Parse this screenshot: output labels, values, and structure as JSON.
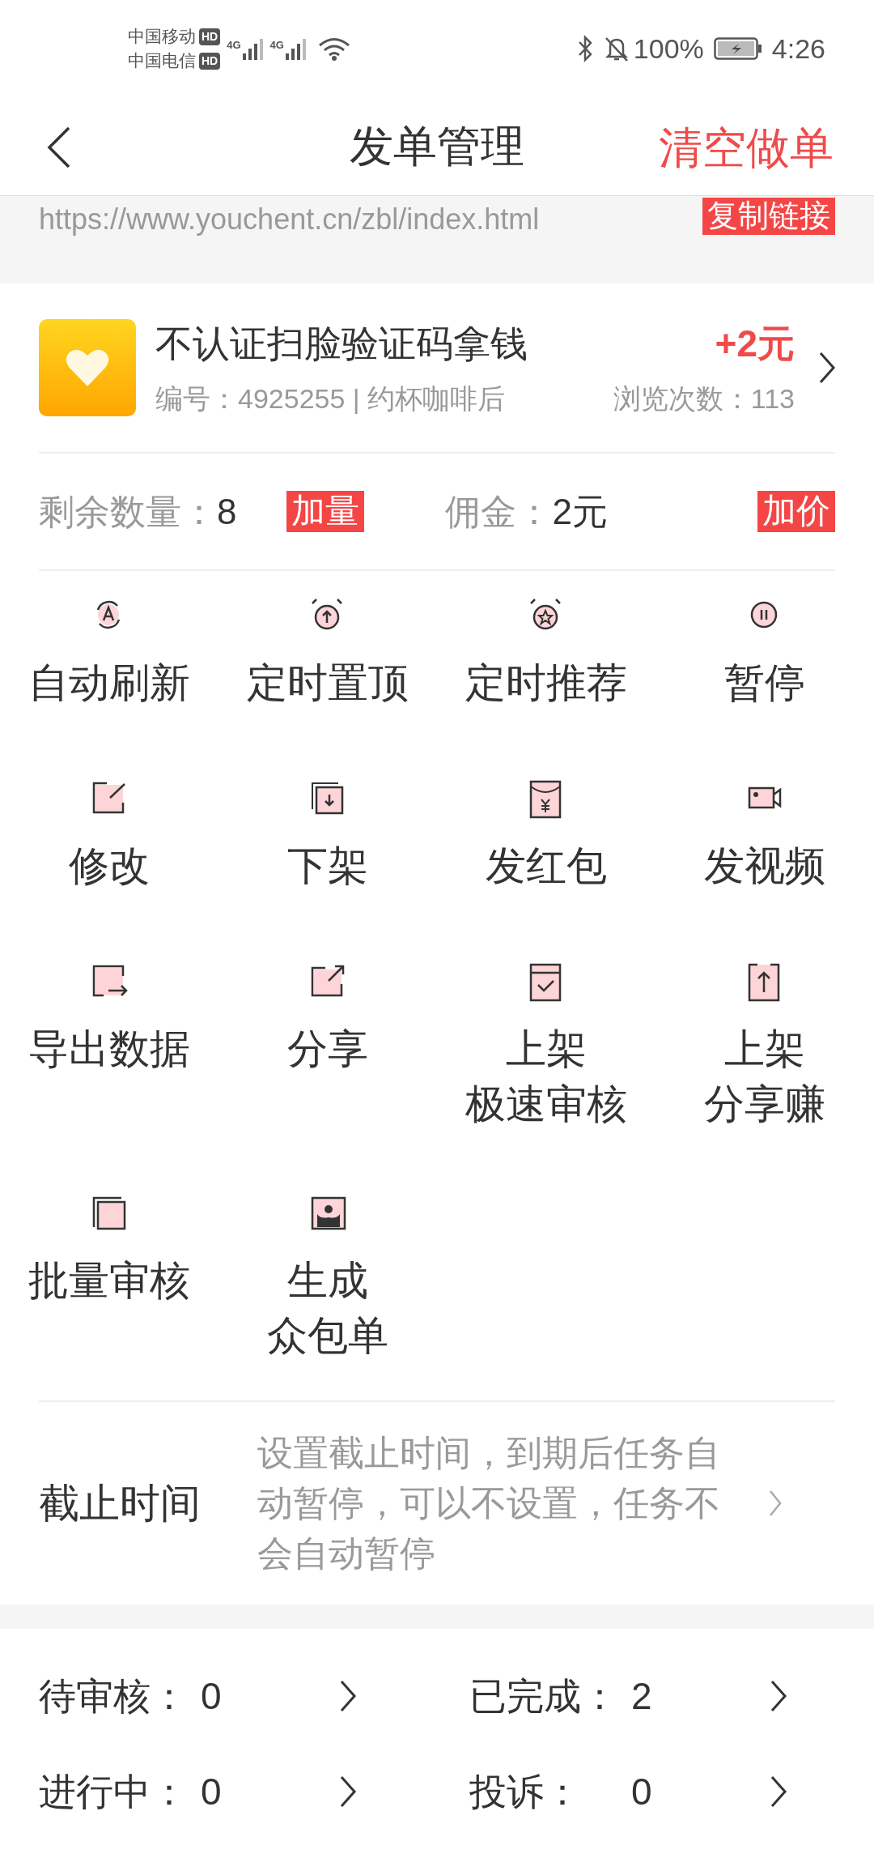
{
  "status_bar": {
    "carriers": [
      "中国移动",
      "中国电信"
    ],
    "hd_badges": [
      "HD",
      "HD"
    ],
    "networks": [
      "4G",
      "4G"
    ],
    "battery_percent": "100%",
    "time": "4:26"
  },
  "header": {
    "title": "发单管理",
    "action": "清空做单"
  },
  "link": {
    "url": "https://www.youchent.cn/zbl/index.html",
    "copy_button": "复制链接"
  },
  "task": {
    "title": "不认证扫脸验证码拿钱",
    "reward": "+2元",
    "meta": "编号：4925255 | 约杯咖啡后",
    "views": "浏览次数：113"
  },
  "quota": {
    "remaining_label": "剩余数量：",
    "remaining": "8",
    "add_quantity": "加量",
    "commission_label": "佣金：",
    "commission": "2元",
    "add_price": "加价"
  },
  "actions": [
    {
      "kind": "refresh",
      "lines": [
        "自动刷新"
      ]
    },
    {
      "kind": "timer-up",
      "lines": [
        "定时置顶"
      ]
    },
    {
      "kind": "timer-star",
      "lines": [
        "定时推荐"
      ]
    },
    {
      "kind": "pause",
      "lines": [
        "暂停"
      ]
    },
    {
      "kind": "edit",
      "lines": [
        "修改"
      ]
    },
    {
      "kind": "down",
      "lines": [
        "下架"
      ]
    },
    {
      "kind": "envelope",
      "lines": [
        "发红包"
      ]
    },
    {
      "kind": "video",
      "lines": [
        "发视频"
      ]
    },
    {
      "kind": "export",
      "lines": [
        "导出数据"
      ]
    },
    {
      "kind": "share",
      "lines": [
        "分享"
      ]
    },
    {
      "kind": "check",
      "lines": [
        "上架",
        "极速审核"
      ]
    },
    {
      "kind": "upload",
      "lines": [
        "上架",
        "分享赚"
      ]
    },
    {
      "kind": "stack",
      "lines": [
        "批量审核"
      ]
    },
    {
      "kind": "person",
      "lines": [
        "生成",
        "众包单"
      ]
    }
  ],
  "deadline": {
    "label": "截止时间",
    "hint": "设置截止时间，到期后任务自动暂停，可以不设置，任务不会自动暂停"
  },
  "counts": [
    {
      "label": "待审核：",
      "value": "0"
    },
    {
      "label": "已完成：",
      "value": "2"
    },
    {
      "label": "进行中：",
      "value": "0"
    },
    {
      "label": "投诉：",
      "value": "0"
    }
  ]
}
